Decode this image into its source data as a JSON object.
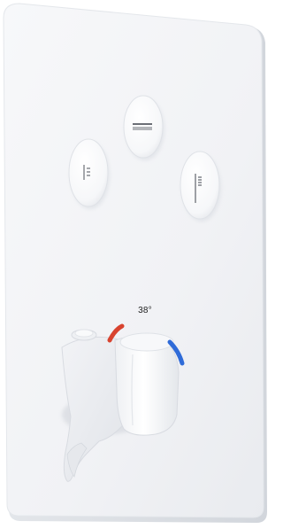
{
  "product": {
    "temperature_marking": "38°",
    "controls": [
      {
        "function": "overhead-shower",
        "icon": "rain-shower-icon",
        "interactive": true
      },
      {
        "function": "hand-shower",
        "icon": "hand-shower-icon",
        "interactive": true
      },
      {
        "function": "spout",
        "icon": "shower-rail-icon",
        "interactive": true
      }
    ],
    "thermostat": {
      "hot_marker_color": "#d8432f",
      "cold_marker_color": "#2f6bd8"
    },
    "colors": {
      "plate": "#f4f5f7",
      "plate_edge": "#dcdfe4",
      "button": "#fbfbfc",
      "icon": "#6b6f76"
    }
  }
}
